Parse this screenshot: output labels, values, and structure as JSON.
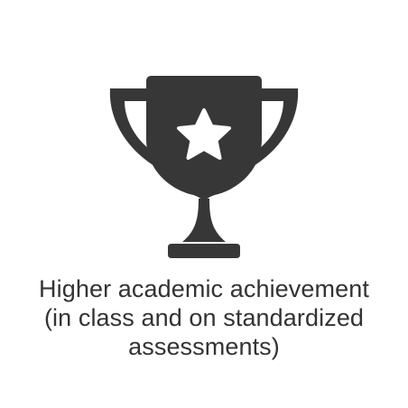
{
  "icon": {
    "name": "trophy-icon",
    "inner_icon": "star-icon",
    "color": "#373737",
    "star_color": "#ffffff"
  },
  "caption": {
    "lines": [
      "Higher academic achievement",
      "(in class and on standardized",
      "assessments)"
    ]
  }
}
